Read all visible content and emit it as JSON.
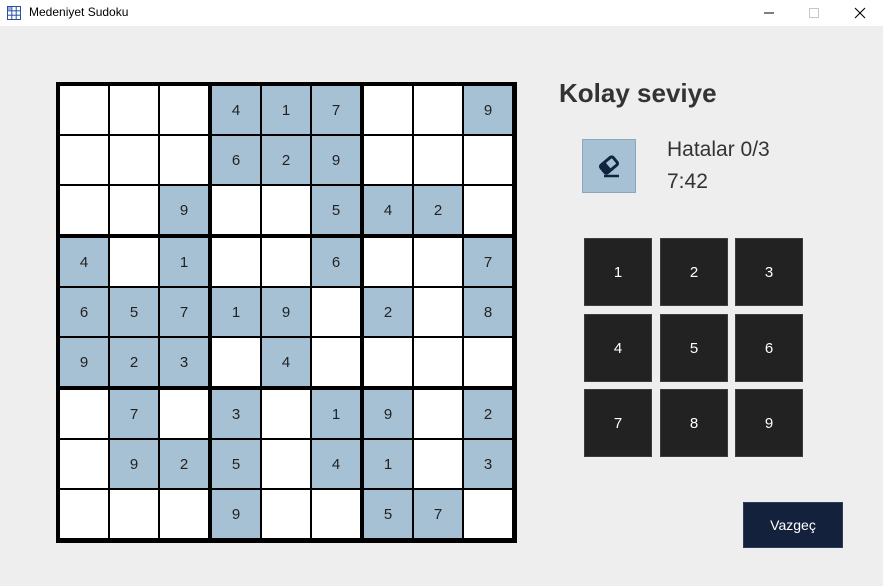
{
  "window": {
    "title": "Medeniyet Sudoku",
    "controls": [
      "minimize-icon",
      "maximize-icon",
      "close-icon"
    ]
  },
  "game": {
    "level_title": "Kolay seviye",
    "errors": "Hatalar 0/3",
    "timer": "7:42",
    "eraser_icon": "eraser-icon",
    "cancel_label": "Vazgeç"
  },
  "board": {
    "rows": [
      [
        "",
        "",
        "",
        "4",
        "1",
        "7",
        "",
        "",
        "9"
      ],
      [
        "",
        "",
        "",
        "6",
        "2",
        "9",
        "",
        "",
        ""
      ],
      [
        "",
        "",
        "9",
        "",
        "",
        "5",
        "4",
        "2",
        ""
      ],
      [
        "4",
        "",
        "1",
        "",
        "",
        "6",
        "",
        "",
        "7"
      ],
      [
        "6",
        "5",
        "7",
        "1",
        "9",
        "",
        "2",
        "",
        "8"
      ],
      [
        "9",
        "2",
        "3",
        "",
        "4",
        "",
        "",
        "",
        ""
      ],
      [
        "",
        "7",
        "",
        "3",
        "",
        "1",
        "9",
        "",
        "2"
      ],
      [
        "",
        "9",
        "2",
        "5",
        "",
        "4",
        "1",
        "",
        "3"
      ],
      [
        "",
        "",
        "",
        "9",
        "",
        "",
        "5",
        "7",
        ""
      ]
    ]
  },
  "numpad": [
    "1",
    "2",
    "3",
    "4",
    "5",
    "6",
    "7",
    "8",
    "9"
  ],
  "colors": {
    "given_cell": "#a7c1d4",
    "empty_cell": "#ffffff",
    "grid_line": "#000000",
    "numpad_bg": "#222222",
    "cancel_bg": "#14213d",
    "background": "#eeeeee"
  }
}
